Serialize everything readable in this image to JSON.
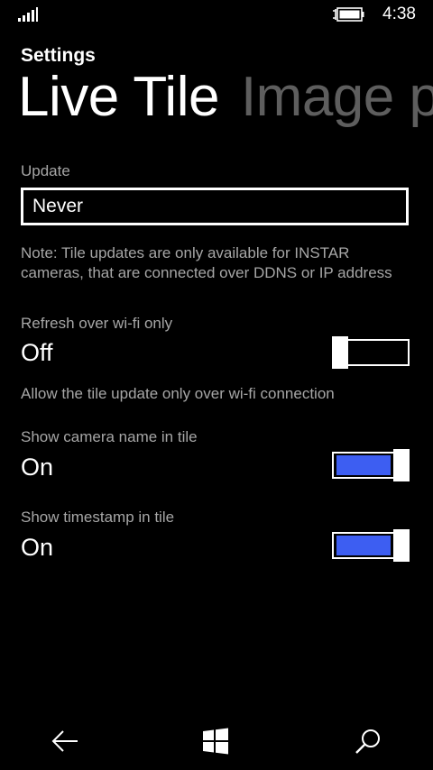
{
  "status_bar": {
    "time": "4:38",
    "signal_icon": "signal-strength-icon",
    "battery_icon": "battery-charging-icon"
  },
  "header": {
    "app_title": "Settings",
    "pivots": [
      {
        "label": "Live Tile",
        "active": true
      },
      {
        "label": "Image p",
        "active": false
      }
    ]
  },
  "update": {
    "label": "Update",
    "selected": "Never",
    "note": "Note: Tile updates are only available for INSTAR cameras, that are connected over DDNS or IP address"
  },
  "settings": [
    {
      "label": "Refresh over wi-fi only",
      "state": "Off",
      "on": false,
      "description": "Allow the tile update only over wi-fi connection"
    },
    {
      "label": "Show camera name in tile",
      "state": "On",
      "on": true
    },
    {
      "label": "Show timestamp in tile",
      "state": "On",
      "on": true
    }
  ],
  "app_bar": {
    "back_icon": "back-arrow-icon",
    "start_icon": "windows-start-icon",
    "search_icon": "search-icon"
  },
  "colors": {
    "accent": "#3d5ef2",
    "background": "#000000",
    "secondary_text": "#a6a6a6",
    "inactive_pivot": "#5e5e5e"
  }
}
